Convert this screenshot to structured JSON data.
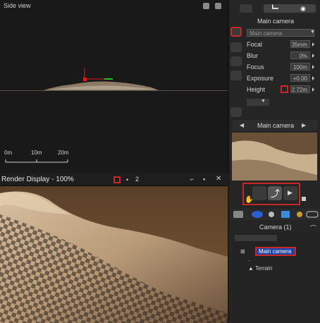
{
  "side_view": {
    "title": "Side view",
    "scale": {
      "a": "0m",
      "b": "10m",
      "c": "20m"
    }
  },
  "render_display": {
    "title": "Render Display - 100%",
    "counter": "2"
  },
  "camera_panel": {
    "title": "Main camera",
    "selected": "Main camera",
    "fields": [
      {
        "label": "Focal",
        "value": "35mm"
      },
      {
        "label": "Blur",
        "value": "0%"
      },
      {
        "label": "Focus",
        "value": "100m"
      },
      {
        "label": "Exposure",
        "value": "+0.00"
      },
      {
        "label": "Height",
        "value": "2.72m"
      }
    ]
  },
  "camera_nav": {
    "title": "Main camera"
  },
  "tree": {
    "title": "Camera (1)",
    "items": [
      "Main camera",
      "Terrain"
    ]
  },
  "colors": {
    "highlight": "#c62828",
    "selection": "#1e44a8",
    "axis_red": "#d42020",
    "axis_green": "#2dbb2d"
  }
}
